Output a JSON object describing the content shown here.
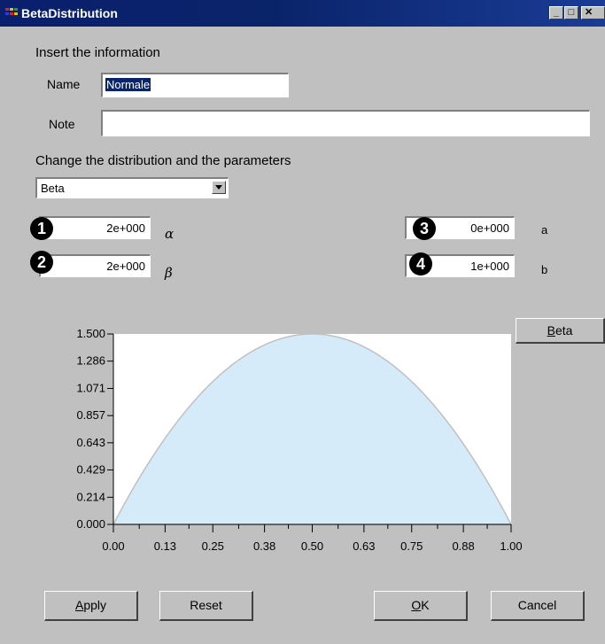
{
  "window": {
    "title": "BetaDistribution"
  },
  "colors": {
    "title_bar": "#0a246a",
    "curve_fill": "#d6ebf9",
    "curve_stroke": "#c0c0c0",
    "selection": "#0a246a"
  },
  "icons": {
    "app": "app-icon",
    "minimize": "minimize-icon",
    "maximize": "maximize-icon",
    "close": "close-icon",
    "dropdown": "chevron-down-icon"
  },
  "labels": {
    "insert_info": "Insert the information",
    "name": "Name",
    "note": "Note",
    "change_dist": "Change the distribution and the parameters"
  },
  "inputs": {
    "name_value": "Normale",
    "note_value": ""
  },
  "distribution": {
    "selected": "Beta"
  },
  "params": {
    "alpha": {
      "badge": "1",
      "value": "2e+000",
      "symbol": "α"
    },
    "beta": {
      "badge": "2",
      "value": "2e+000",
      "symbol": "β"
    },
    "a": {
      "badge": "3",
      "value": "0e+000",
      "symbol": "a"
    },
    "b": {
      "badge": "4",
      "value": "1e+000",
      "symbol": "b"
    }
  },
  "chart_button": "Beta",
  "buttons": {
    "apply": "Apply",
    "reset": "Reset",
    "ok": "OK",
    "cancel": "Cancel"
  },
  "chart_data": {
    "type": "area",
    "function": "beta_pdf",
    "alpha": 2,
    "beta": 2,
    "x": [
      0.0,
      0.13,
      0.25,
      0.38,
      0.5,
      0.63,
      0.75,
      0.88,
      1.0
    ],
    "y": [
      0.0,
      0.679,
      1.125,
      1.414,
      1.5,
      1.398,
      1.125,
      0.634,
      0.0
    ],
    "xlim": [
      0,
      1
    ],
    "ylim": [
      0,
      1.5
    ],
    "x_tick_labels": [
      "0.00",
      "0.13",
      "0.25",
      "0.38",
      "0.50",
      "0.63",
      "0.75",
      "0.88",
      "1.00"
    ],
    "y_tick_labels": [
      "0.000",
      "0.214",
      "0.429",
      "0.643",
      "0.857",
      "1.071",
      "1.286",
      "1.500"
    ],
    "title": "",
    "xlabel": "",
    "ylabel": "",
    "grid": false
  }
}
